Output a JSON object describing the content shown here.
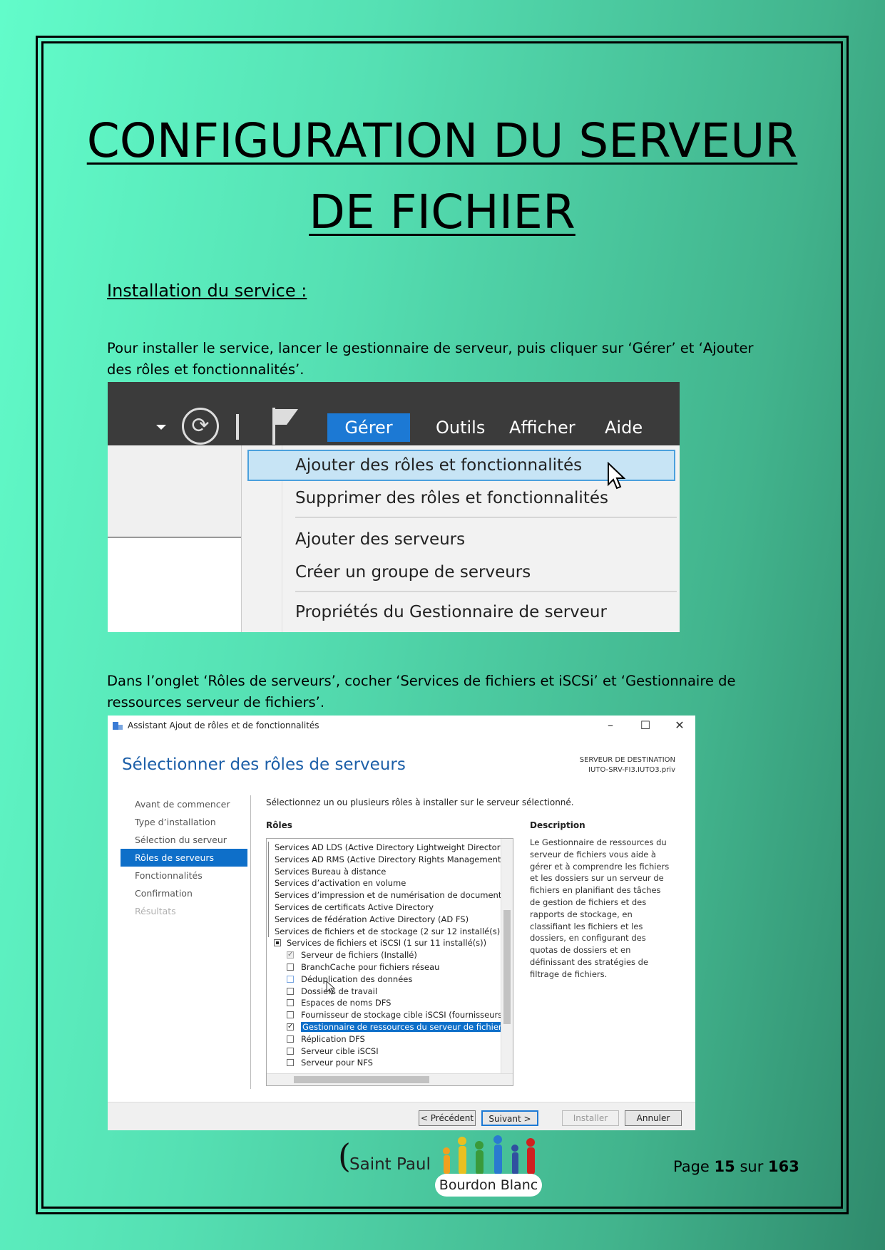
{
  "title": {
    "line1": "CONFIGURATION DU SERVEUR",
    "line2": "DE FICHIER"
  },
  "section_heading": "Installation du service :",
  "paragraph1": "Pour installer le service, lancer le gestionnaire de serveur, puis cliquer sur ‘Gérer’ et ‘Ajouter des rôles et fonctionnalités’.",
  "paragraph2": "Dans l’onglet ‘Rôles de serveurs’, cocher ‘Services de fichiers et iSCSi’ et ‘Gestionnaire de ressources serveur de fichiers’.",
  "screenshot1": {
    "menubar": [
      "Gérer",
      "Outils",
      "Afficher",
      "Aide"
    ],
    "dropdown": [
      "Ajouter des rôles et fonctionnalités",
      "Supprimer des rôles et fonctionnalités",
      "Ajouter des serveurs",
      "Créer un groupe de serveurs",
      "Propriétés du Gestionnaire de serveur"
    ],
    "icons": [
      "dropdown-caret-icon",
      "refresh-icon",
      "flag-icon",
      "mouse-cursor-icon"
    ]
  },
  "screenshot2": {
    "window_title": "Assistant Ajout de rôles et de fonctionnalités",
    "window_buttons": [
      "–",
      "☐",
      "✕"
    ],
    "heading": "Sélectionner des rôles de serveurs",
    "destination_label": "SERVEUR DE DESTINATION",
    "destination_server": "IUTO-SRV-FI3.IUTO3.priv",
    "nav": [
      "Avant de commencer",
      "Type d’installation",
      "Sélection du serveur",
      "Rôles de serveurs",
      "Fonctionnalités",
      "Confirmation",
      "Résultats"
    ],
    "instruction": "Sélectionnez un ou plusieurs rôles à installer sur le serveur sélectionné.",
    "roles_label": "Rôles",
    "description_label": "Description",
    "roles": [
      {
        "text": "Services AD LDS (Active Directory Lightweight Directory S",
        "level": 0
      },
      {
        "text": "Services AD RMS (Active Directory Rights Management S",
        "level": 0
      },
      {
        "text": "Services Bureau à distance",
        "level": 0
      },
      {
        "text": "Services d’activation en volume",
        "level": 0
      },
      {
        "text": "Services d’impression et de numérisation de document",
        "level": 0
      },
      {
        "text": "Services de certificats Active Directory",
        "level": 0
      },
      {
        "text": "Services de fédération Active Directory (AD FS)",
        "level": 0
      },
      {
        "text": "Services de fichiers et de stockage (2 sur 12 installé(s))",
        "level": 0
      },
      {
        "text": "Services de fichiers et iSCSI (1 sur 11 installé(s))",
        "level": 1,
        "state": "partial"
      },
      {
        "text": "Serveur de fichiers (Installé)",
        "level": 2,
        "state": "checked-disabled"
      },
      {
        "text": "BranchCache pour fichiers réseau",
        "level": 2,
        "state": "unchecked"
      },
      {
        "text": "Déduplication des données",
        "level": 2,
        "state": "unchecked"
      },
      {
        "text": "Dossiers de travail",
        "level": 2,
        "state": "unchecked"
      },
      {
        "text": "Espaces de noms DFS",
        "level": 2,
        "state": "unchecked"
      },
      {
        "text": "Fournisseur de stockage cible iSCSI (fournisseurs c",
        "level": 2,
        "state": "unchecked"
      },
      {
        "text": "Gestionnaire de ressources du serveur de fichiers",
        "level": 2,
        "state": "checked",
        "selected": true
      },
      {
        "text": "Réplication DFS",
        "level": 2,
        "state": "unchecked"
      },
      {
        "text": "Serveur cible iSCSI",
        "level": 2,
        "state": "unchecked"
      },
      {
        "text": "Serveur pour NFS",
        "level": 2,
        "state": "unchecked"
      }
    ],
    "description": "Le Gestionnaire de ressources du serveur de fichiers vous aide à gérer et à comprendre les fichiers et les dossiers sur un serveur de fichiers en planifiant des tâches de gestion de fichiers et des rapports de stockage, en classifiant les fichiers et les dossiers, en configurant des quotas de dossiers et en définissant des stratégies de filtrage de fichiers.",
    "buttons": {
      "previous": "< Précédent",
      "next": "Suivant >",
      "install": "Installer",
      "cancel": "Annuler"
    }
  },
  "footer": {
    "logo_paren": "(",
    "logo_saint": "Saint Paul",
    "logo_badge": "Bourdon Blanc",
    "page_prefix": "Page",
    "page_current": "15",
    "page_sep": "sur",
    "page_total": "163"
  }
}
